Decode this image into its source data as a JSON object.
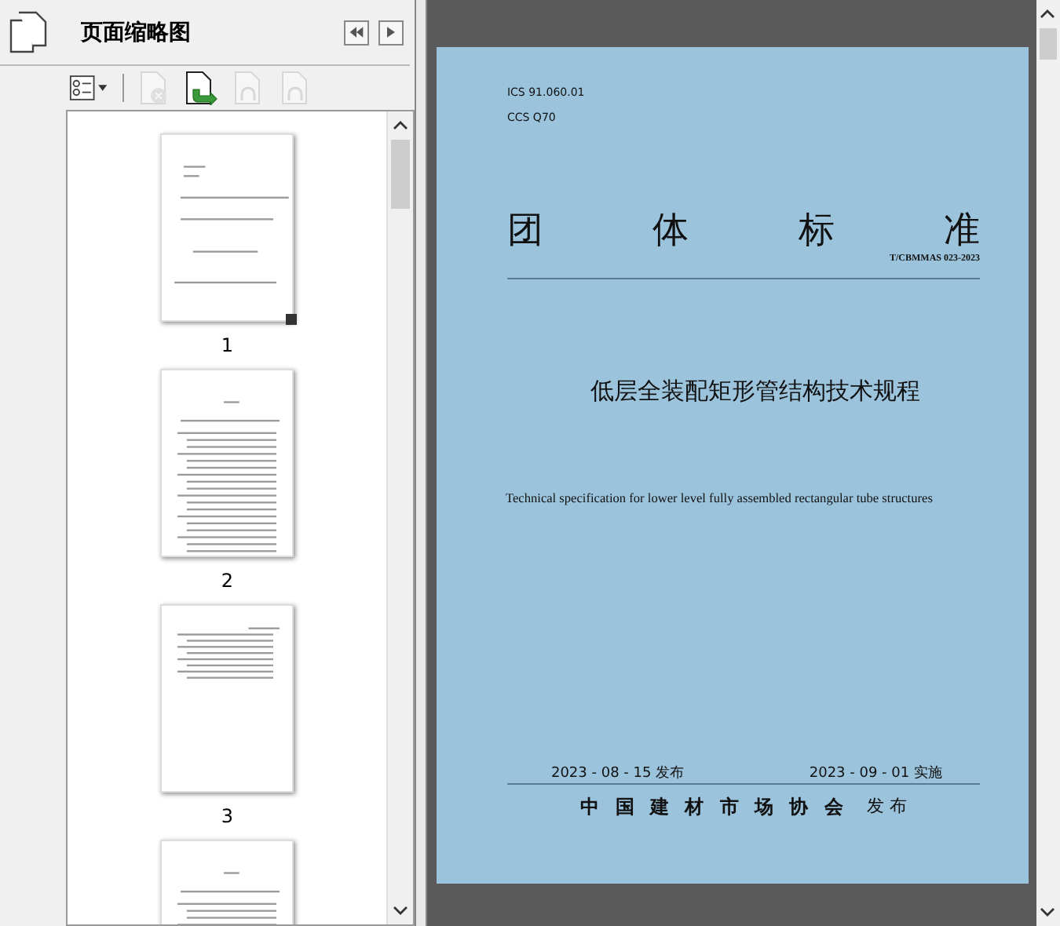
{
  "panel": {
    "title": "页面缩略图"
  },
  "toolbar": [
    {
      "kind": "options",
      "disabled": false
    },
    {
      "kind": "delete",
      "disabled": true
    },
    {
      "kind": "insert",
      "disabled": false
    },
    {
      "kind": "undo",
      "disabled": true
    },
    {
      "kind": "redo",
      "disabled": true
    }
  ],
  "thumbnails": [
    {
      "kind": "cover",
      "label": "1",
      "current": true
    },
    {
      "kind": "toc",
      "label": "2",
      "current": false
    },
    {
      "kind": "text",
      "label": "3",
      "current": false
    },
    {
      "kind": "toc",
      "current": false
    }
  ],
  "page": {
    "ics": "ICS 91.060.01",
    "ccs": "CCS Q70",
    "heading_chars": [
      "团",
      "体",
      "标",
      "准"
    ],
    "code": "T/CBMMAS 023-2023",
    "title": "低层全装配矩形管结构技术规程",
    "subtitle_en": "Technical specification for lower level fully assembled rectangular tube structures",
    "issue_date": "2023 - 08 - 15 发布",
    "effective_date": "2023 - 09 - 01 实施",
    "issuer": "中 国 建 材 市 场 协 会",
    "issuer_action": "发 布"
  }
}
